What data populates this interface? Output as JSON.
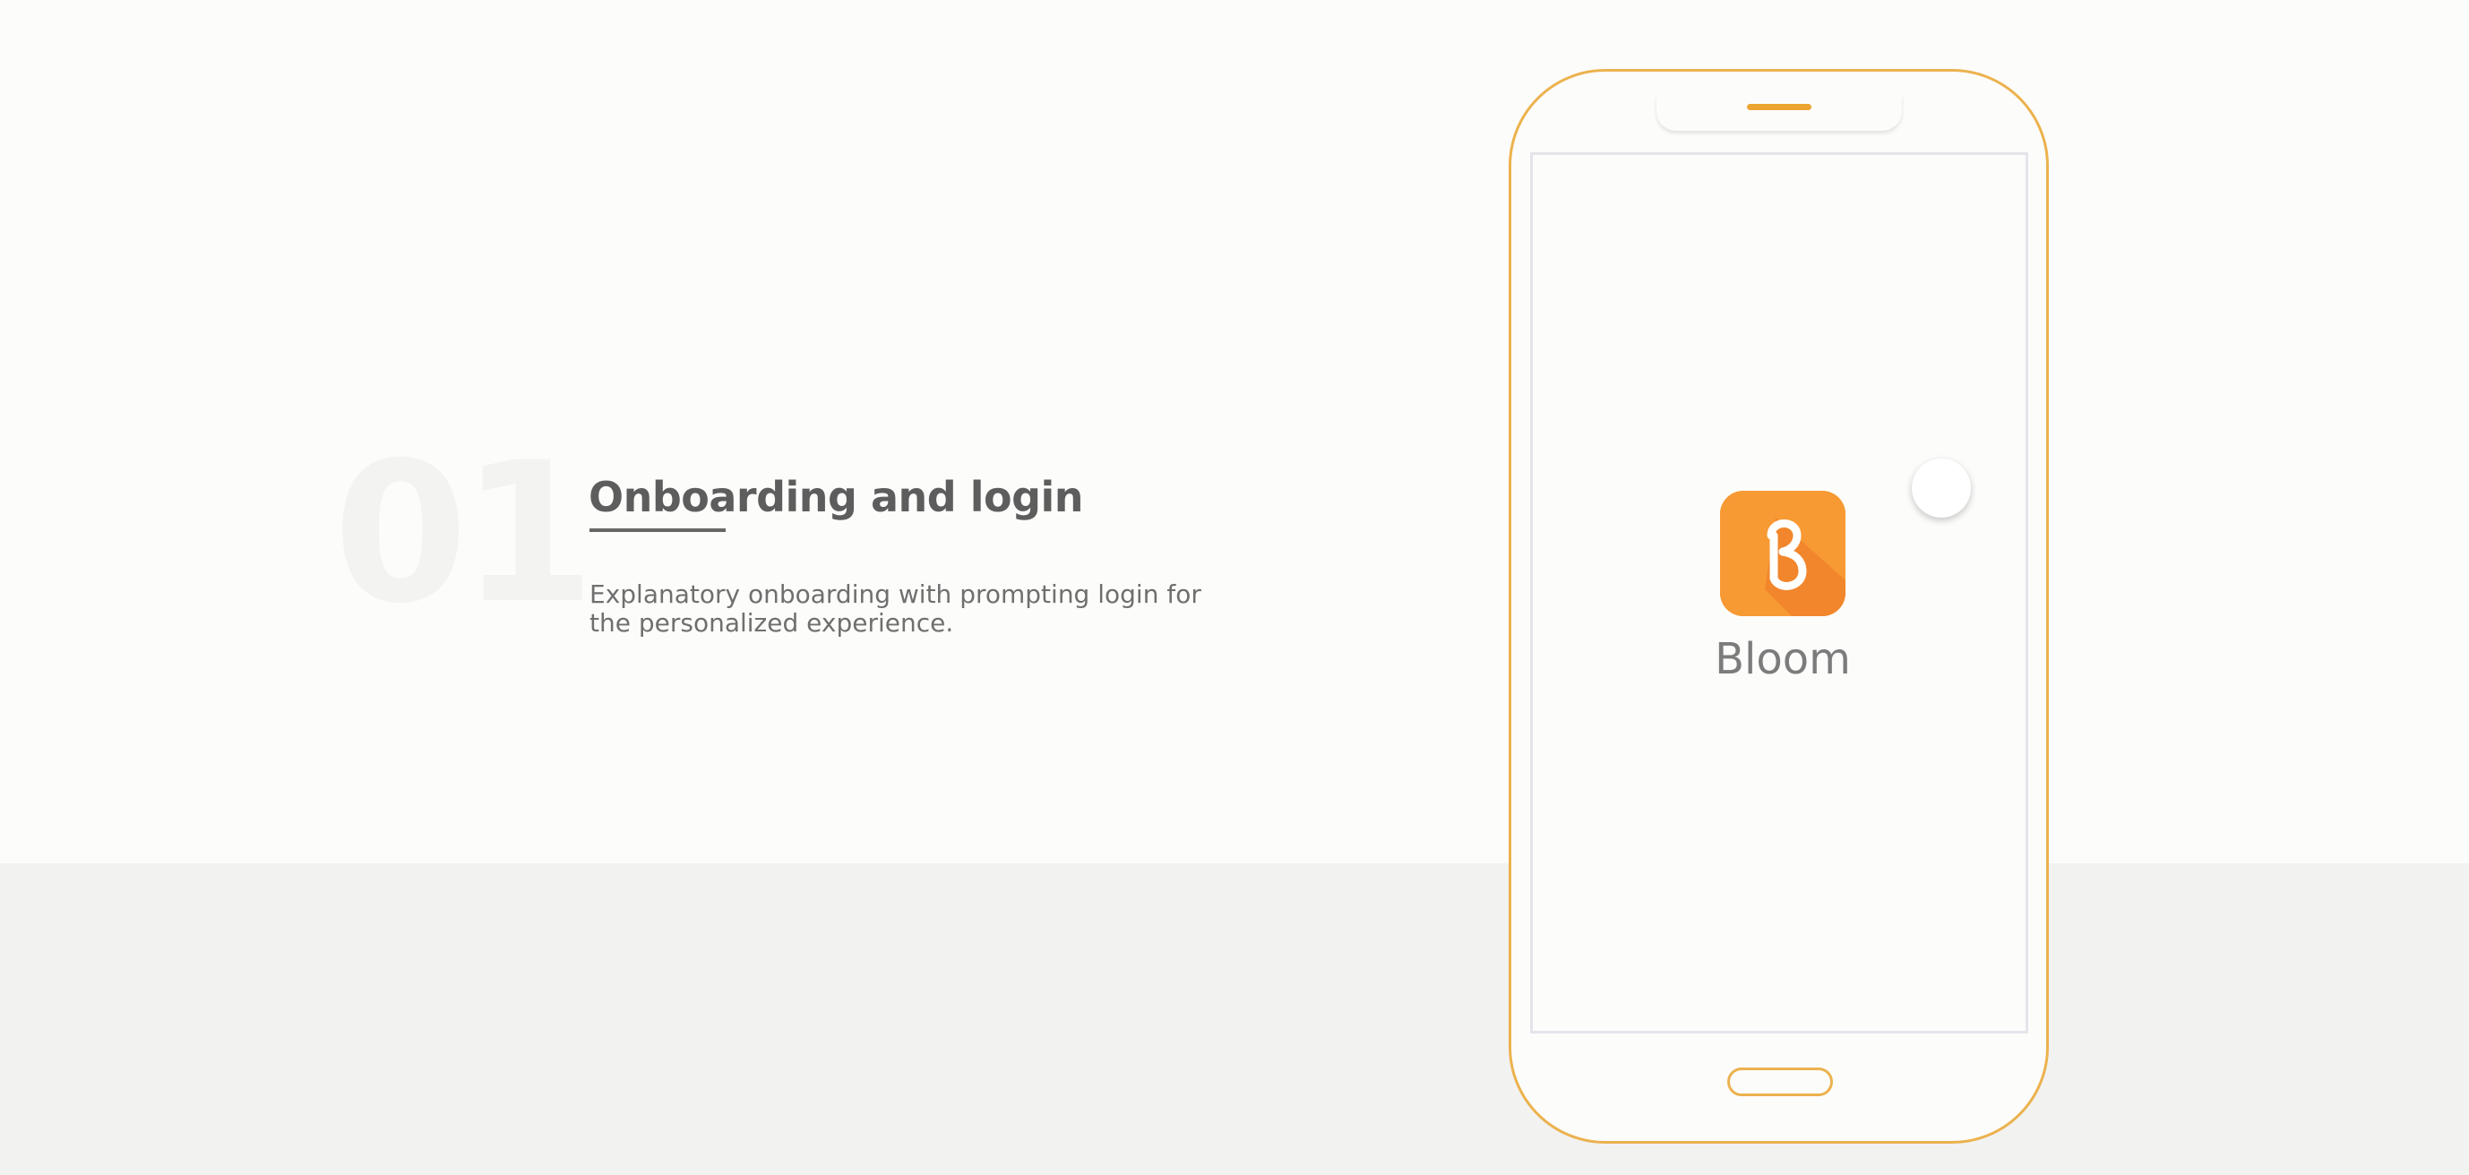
{
  "section": {
    "number": "01",
    "title": "Onboarding and login",
    "description": "Explanatory onboarding with prompting login for the personalized experience."
  },
  "app": {
    "name": "Bloom",
    "icon": "bloom-logo-icon"
  },
  "colors": {
    "accent": "#f79a33",
    "phone_outline": "#ecb24e",
    "text_dark": "#5d5d5d",
    "text_muted": "#6f6f6f",
    "background": "#fcfcfa",
    "band": "#f2f2f1"
  }
}
